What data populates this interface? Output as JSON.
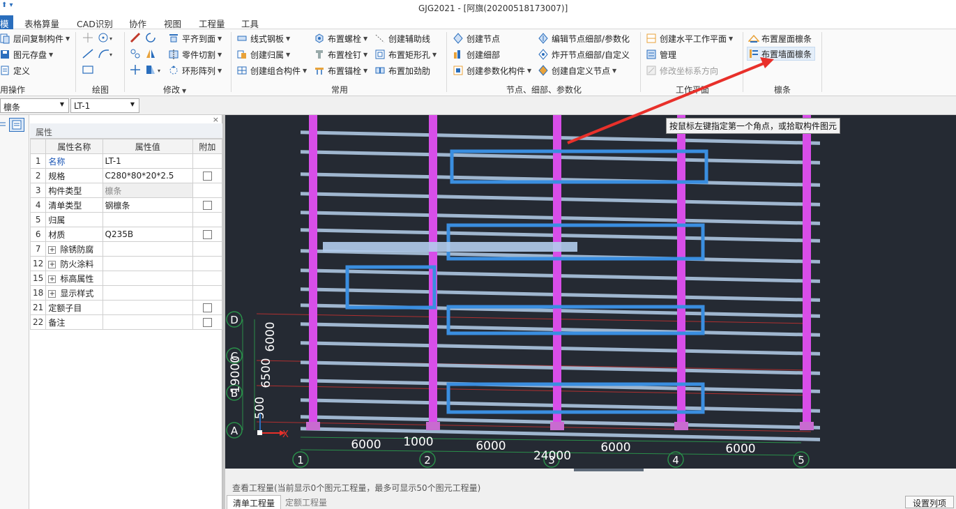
{
  "window": {
    "title": "GJG2021 - [阿旗(20200518173007)]"
  },
  "menu": {
    "items": [
      "模",
      "表格算量",
      "CAD识别",
      "协作",
      "视图",
      "工程量",
      "工具"
    ]
  },
  "ribbon": {
    "groups": {
      "element_ops": {
        "label": "用操作",
        "items": [
          "层间复制构件",
          "图元存盘",
          "定义"
        ]
      },
      "draw": {
        "label": "绘图"
      },
      "modify": {
        "label": "修改",
        "items": [
          "平齐到面",
          "零件切割",
          "环形阵列"
        ]
      },
      "common": {
        "label": "常用",
        "items": [
          "线式钢板",
          "创建归属",
          "创建组合构件",
          "布置螺栓",
          "布置栓钉",
          "布置锚栓",
          "创建辅助线",
          "布置矩形孔",
          "布置加劲肋"
        ]
      },
      "nodes": {
        "label": "节点、细部、参数化",
        "items": [
          "创建节点",
          "创建细部",
          "创建参数化构件",
          "编辑节点细部/参数化",
          "炸开节点细部/自定义",
          "创建自定义节点"
        ]
      },
      "workplane": {
        "label": "工作平面",
        "items": [
          "创建水平工作平面",
          "管理",
          "修改坐标系方向"
        ]
      },
      "purlin": {
        "label": "檩条",
        "items": [
          "布置屋面檩条",
          "布置墙面檩条"
        ]
      }
    }
  },
  "selectors": {
    "type": "檩条",
    "component": "LT-1"
  },
  "properties": {
    "panel_title": "属性",
    "headers": [
      "属性名称",
      "属性值",
      "附加"
    ],
    "rows": [
      {
        "num": "1",
        "name": "名称",
        "value": "LT-1"
      },
      {
        "num": "2",
        "name": "规格",
        "value": "C280*80*20*2.5"
      },
      {
        "num": "3",
        "name": "构件类型",
        "value": "檩条"
      },
      {
        "num": "4",
        "name": "清单类型",
        "value": "钢檩条"
      },
      {
        "num": "5",
        "name": "归属",
        "value": ""
      },
      {
        "num": "6",
        "name": "材质",
        "value": "Q235B"
      },
      {
        "num": "7",
        "name": "除锈防腐",
        "value": ""
      },
      {
        "num": "12",
        "name": "防火涂料",
        "value": ""
      },
      {
        "num": "15",
        "name": "标高属性",
        "value": ""
      },
      {
        "num": "18",
        "name": "显示样式",
        "value": ""
      },
      {
        "num": "21",
        "name": "定额子目",
        "value": ""
      },
      {
        "num": "22",
        "name": "备注",
        "value": ""
      }
    ]
  },
  "viewport": {
    "tooltip": "按鼠标左键指定第一个角点，或拾取构件图元",
    "axis_x_labels": [
      "1",
      "2",
      "3",
      "4",
      "5"
    ],
    "axis_y_labels": [
      "A",
      "B",
      "C",
      "D"
    ],
    "dims_x": [
      "6000",
      "1000",
      "6000",
      "6000",
      "6000"
    ],
    "dim_total_x": "24000",
    "dims_y": [
      "6000",
      "6500",
      "500"
    ],
    "dim_total_y": "19000",
    "ucs_x": "X",
    "colors": {
      "background": "#252a33",
      "column": "#d84ee8",
      "purlin": "#9fb6cf",
      "member": "#3a8ee0",
      "annotation_arrow": "#e8302a"
    }
  },
  "quantities": {
    "title": "查看工程量(当前显示0个图元工程量，最多可显示50个图元工程量)",
    "tabs": [
      "清单工程量",
      "定额工程量"
    ],
    "set_columns": "设置列项"
  }
}
